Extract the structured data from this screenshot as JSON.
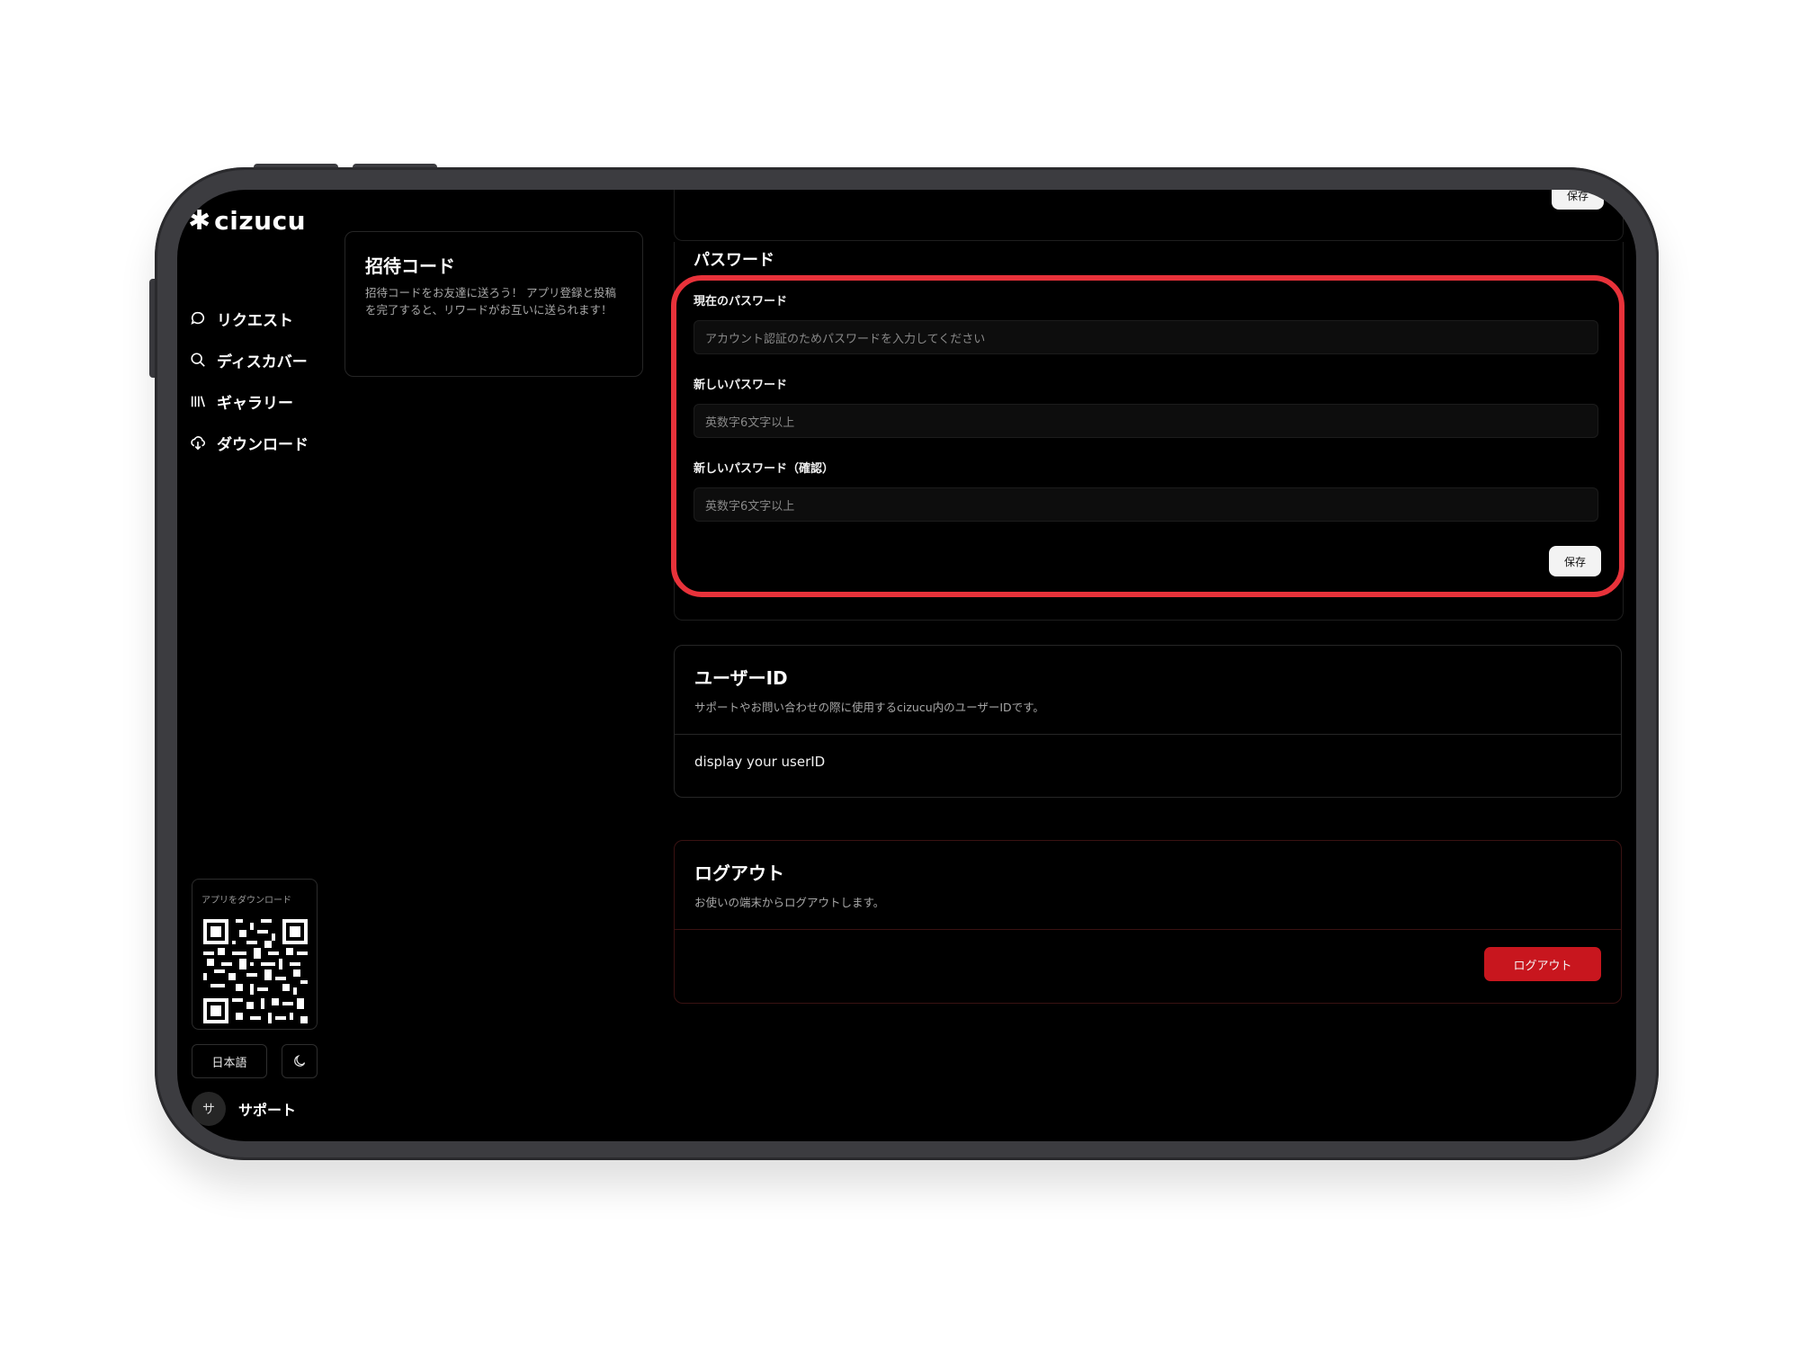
{
  "app": {
    "logo_text": "cizucu"
  },
  "sidebar": {
    "items": [
      {
        "label": "リクエスト",
        "icon": "chat-bubble-icon"
      },
      {
        "label": "ディスカバー",
        "icon": "search-icon"
      },
      {
        "label": "ギャラリー",
        "icon": "library-icon"
      },
      {
        "label": "ダウンロード",
        "icon": "cloud-download-icon"
      }
    ],
    "qr_label": "アプリをダウンロード",
    "language_label": "日本語",
    "support": {
      "avatar_initial": "サ",
      "label": "サポート"
    }
  },
  "invite": {
    "title": "招待コード",
    "description": "招待コードをお友達に送ろう！ アプリ登録と投稿を完了すると、リワードがお互いに送られます！"
  },
  "top_card": {
    "save_label": "保存"
  },
  "password": {
    "title": "パスワード",
    "current_label": "現在のパスワード",
    "current_placeholder": "アカウント認証のためパスワードを入力してください",
    "new_label": "新しいパスワード",
    "new_placeholder": "英数字6文字以上",
    "confirm_label": "新しいパスワード（確認）",
    "confirm_placeholder": "英数字6文字以上",
    "save_label": "保存"
  },
  "user_id": {
    "title": "ユーザーID",
    "description": "サポートやお問い合わせの際に使用するcizucu内のユーザーIDです。",
    "value": "display your userID"
  },
  "logout": {
    "title": "ログアウト",
    "description": "お使いの端末からログアウトします。",
    "button_label": "ログアウト"
  },
  "colors": {
    "highlight": "#e8323a",
    "logout_button": "#c8161e"
  }
}
